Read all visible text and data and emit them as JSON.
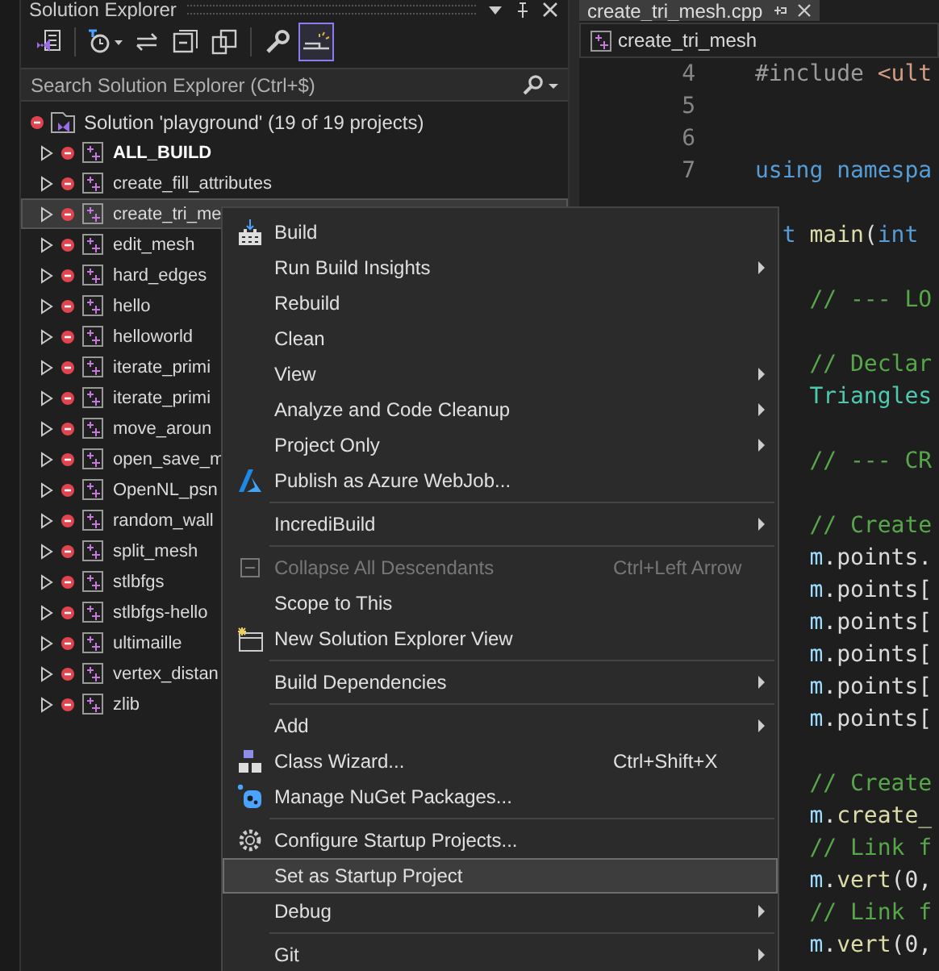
{
  "solution_explorer": {
    "title": "Solution Explorer",
    "toolbar": [
      {
        "selected": false
      },
      {
        "selected": false
      },
      {
        "selected": false
      },
      {
        "selected": false
      },
      {
        "selected": false
      },
      {
        "selected": false
      },
      {
        "selected": true
      }
    ],
    "search": {
      "placeholder": "Search Solution Explorer (Ctrl+$)"
    },
    "solution": {
      "label": "Solution 'playground' (19 of 19 projects)"
    },
    "projects": [
      {
        "label": "ALL_BUILD",
        "bold": true,
        "selected": false
      },
      {
        "label": "create_fill_attributes",
        "bold": false,
        "selected": false
      },
      {
        "label": "create_tri_me",
        "bold": false,
        "selected": true
      },
      {
        "label": "edit_mesh",
        "bold": false,
        "selected": false
      },
      {
        "label": "hard_edges",
        "bold": false,
        "selected": false
      },
      {
        "label": "hello",
        "bold": false,
        "selected": false
      },
      {
        "label": "helloworld",
        "bold": false,
        "selected": false
      },
      {
        "label": "iterate_primi",
        "bold": false,
        "selected": false
      },
      {
        "label": "iterate_primi",
        "bold": false,
        "selected": false
      },
      {
        "label": "move_aroun",
        "bold": false,
        "selected": false
      },
      {
        "label": "open_save_m",
        "bold": false,
        "selected": false
      },
      {
        "label": "OpenNL_psn",
        "bold": false,
        "selected": false
      },
      {
        "label": "random_wall",
        "bold": false,
        "selected": false
      },
      {
        "label": "split_mesh",
        "bold": false,
        "selected": false
      },
      {
        "label": "stlbfgs",
        "bold": false,
        "selected": false
      },
      {
        "label": "stlbfgs-hello",
        "bold": false,
        "selected": false
      },
      {
        "label": "ultimaille",
        "bold": false,
        "selected": false
      },
      {
        "label": "vertex_distan",
        "bold": false,
        "selected": false
      },
      {
        "label": "zlib",
        "bold": false,
        "selected": false
      }
    ]
  },
  "editor": {
    "tab": "create_tri_mesh.cpp",
    "nav": "create_tri_mesh",
    "lines": [
      {
        "kind": "code",
        "number": "4",
        "tokens": [
          {
            "text": "#include",
            "kind": "preprocessor"
          },
          {
            "text": " <ult",
            "kind": "string"
          }
        ]
      },
      {
        "kind": "blank",
        "number": "5"
      },
      {
        "kind": "blank",
        "number": "6"
      },
      {
        "kind": "code",
        "number": "7",
        "tokens": [
          {
            "text": "using namespa",
            "kind": "keyword"
          }
        ]
      },
      {
        "kind": "blank"
      },
      {
        "kind": "code",
        "tokens": [
          {
            "text": "t",
            "kind": "keyword"
          },
          {
            "text": " main",
            "kind": "function"
          },
          {
            "text": "(",
            "kind": "plain"
          },
          {
            "text": "int",
            "kind": "keyword"
          }
        ],
        "children": [
          {
            "kind": "blank"
          },
          {
            "kind": "code",
            "tokens": [
              {
                "text": "// --- LO",
                "kind": "comment"
              }
            ]
          },
          {
            "kind": "blank"
          },
          {
            "kind": "code",
            "tokens": [
              {
                "text": "// Declar",
                "kind": "comment"
              }
            ]
          },
          {
            "kind": "code",
            "tokens": [
              {
                "text": "Triangles",
                "kind": "type"
              }
            ]
          },
          {
            "kind": "blank"
          },
          {
            "kind": "code",
            "tokens": [
              {
                "text": "// --- CR",
                "kind": "comment"
              }
            ]
          },
          {
            "kind": "blank"
          },
          {
            "kind": "code",
            "tokens": [
              {
                "text": "// Create",
                "kind": "comment"
              }
            ]
          },
          {
            "kind": "code",
            "tokens": [
              {
                "text": "m",
                "kind": "variable"
              },
              {
                "text": ".points.",
                "kind": "plain"
              }
            ]
          },
          {
            "kind": "code",
            "tokens": [
              {
                "text": "m",
                "kind": "variable"
              },
              {
                "text": ".points[",
                "kind": "plain"
              }
            ]
          },
          {
            "kind": "code",
            "tokens": [
              {
                "text": "m",
                "kind": "variable"
              },
              {
                "text": ".points[",
                "kind": "plain"
              }
            ]
          },
          {
            "kind": "code",
            "tokens": [
              {
                "text": "m",
                "kind": "variable"
              },
              {
                "text": ".points[",
                "kind": "plain"
              }
            ]
          },
          {
            "kind": "code",
            "tokens": [
              {
                "text": "m",
                "kind": "variable"
              },
              {
                "text": ".points[",
                "kind": "plain"
              }
            ]
          },
          {
            "kind": "code",
            "tokens": [
              {
                "text": "m",
                "kind": "variable"
              },
              {
                "text": ".points[",
                "kind": "plain"
              }
            ]
          },
          {
            "kind": "blank"
          },
          {
            "kind": "code",
            "tokens": [
              {
                "text": "// Create",
                "kind": "comment"
              }
            ]
          },
          {
            "kind": "code",
            "tokens": [
              {
                "text": "m",
                "kind": "variable"
              },
              {
                "text": ".",
                "kind": "plain"
              },
              {
                "text": "create_",
                "kind": "function"
              }
            ]
          },
          {
            "kind": "code",
            "tokens": [
              {
                "text": "// Link f",
                "kind": "comment"
              }
            ]
          },
          {
            "kind": "code",
            "tokens": [
              {
                "text": "m",
                "kind": "variable"
              },
              {
                "text": ".",
                "kind": "plain"
              },
              {
                "text": "vert",
                "kind": "function"
              },
              {
                "text": "(0,",
                "kind": "plain"
              }
            ]
          },
          {
            "kind": "code",
            "tokens": [
              {
                "text": "// Link f",
                "kind": "comment"
              }
            ]
          },
          {
            "kind": "code",
            "tokens": [
              {
                "text": "m",
                "kind": "variable"
              },
              {
                "text": ".",
                "kind": "plain"
              },
              {
                "text": "vert",
                "kind": "function"
              },
              {
                "text": "(0,",
                "kind": "plain"
              }
            ]
          }
        ]
      }
    ]
  },
  "context_menu": {
    "items": [
      {
        "kind": "item",
        "label": "Build",
        "submenu": false,
        "disabled": false,
        "selected": false
      },
      {
        "kind": "item",
        "label": "Run Build Insights",
        "submenu": true,
        "disabled": false,
        "selected": false
      },
      {
        "kind": "item",
        "label": "Rebuild",
        "submenu": false,
        "disabled": false,
        "selected": false
      },
      {
        "kind": "item",
        "label": "Clean",
        "submenu": false,
        "disabled": false,
        "selected": false
      },
      {
        "kind": "item",
        "label": "View",
        "submenu": true,
        "disabled": false,
        "selected": false
      },
      {
        "kind": "item",
        "label": "Analyze and Code Cleanup",
        "submenu": true,
        "disabled": false,
        "selected": false
      },
      {
        "kind": "item",
        "label": "Project Only",
        "submenu": true,
        "disabled": false,
        "selected": false
      },
      {
        "kind": "item",
        "label": "Publish as Azure WebJob...",
        "submenu": false,
        "disabled": false,
        "selected": false
      },
      {
        "kind": "separator"
      },
      {
        "kind": "item",
        "label": "IncrediBuild",
        "submenu": true,
        "disabled": false,
        "selected": false
      },
      {
        "kind": "separator"
      },
      {
        "kind": "item",
        "label": "Collapse All Descendants",
        "shortcut": "Ctrl+Left Arrow",
        "submenu": false,
        "disabled": true,
        "selected": false
      },
      {
        "kind": "item",
        "label": "Scope to This",
        "submenu": false,
        "disabled": false,
        "selected": false
      },
      {
        "kind": "item",
        "label": "New Solution Explorer View",
        "submenu": false,
        "disabled": false,
        "selected": false
      },
      {
        "kind": "separator"
      },
      {
        "kind": "item",
        "label": "Build Dependencies",
        "submenu": true,
        "disabled": false,
        "selected": false
      },
      {
        "kind": "separator"
      },
      {
        "kind": "item",
        "label": "Add",
        "submenu": true,
        "disabled": false,
        "selected": false
      },
      {
        "kind": "item",
        "label": "Class Wizard...",
        "shortcut": "Ctrl+Shift+X",
        "submenu": false,
        "disabled": false,
        "selected": false
      },
      {
        "kind": "item",
        "label": "Manage NuGet Packages...",
        "submenu": false,
        "disabled": false,
        "selected": false
      },
      {
        "kind": "separator"
      },
      {
        "kind": "item",
        "label": "Configure Startup Projects...",
        "submenu": false,
        "disabled": false,
        "selected": false
      },
      {
        "kind": "item",
        "label": "Set as Startup Project",
        "submenu": false,
        "disabled": false,
        "selected": true
      },
      {
        "kind": "item",
        "label": "Debug",
        "submenu": true,
        "disabled": false,
        "selected": false
      },
      {
        "kind": "separator"
      },
      {
        "kind": "item",
        "label": "Git",
        "submenu": true,
        "disabled": false,
        "selected": false
      }
    ]
  }
}
